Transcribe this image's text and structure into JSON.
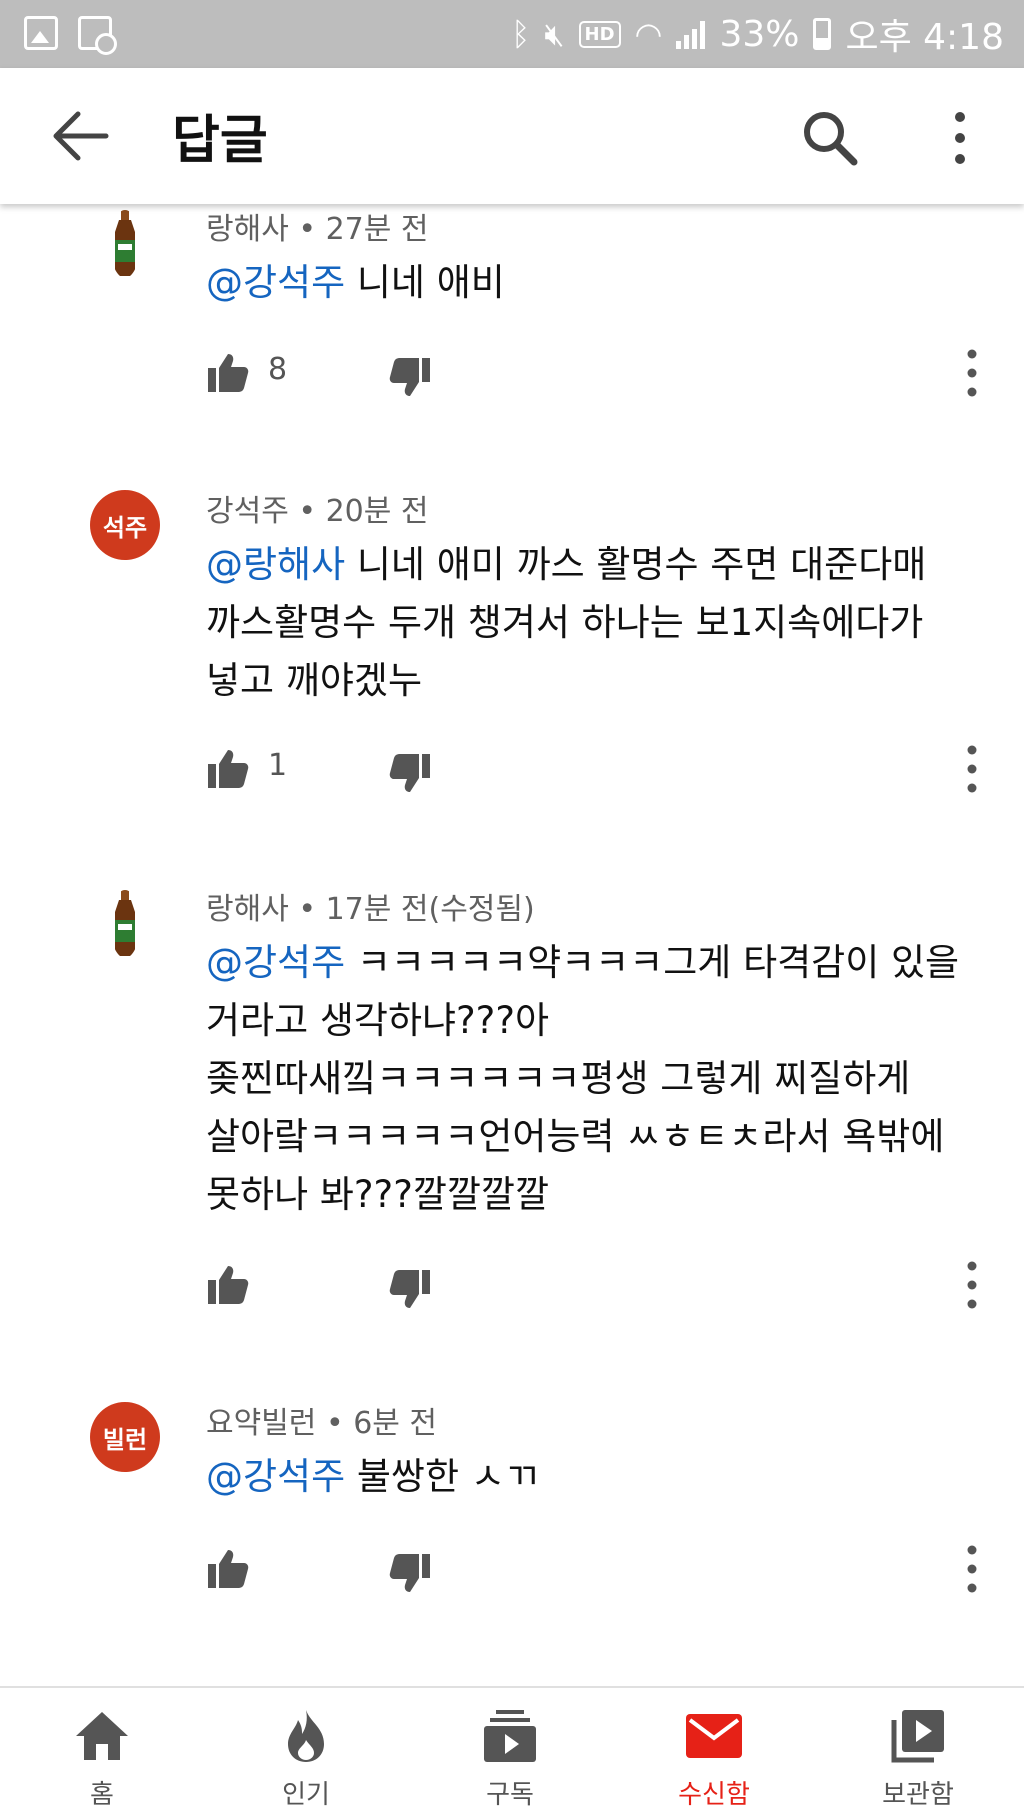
{
  "status_bar": {
    "battery": "33%",
    "time": "오후 4:18",
    "hd_label": "HD"
  },
  "app_bar": {
    "title": "답글"
  },
  "comments": [
    {
      "author": "랑해사",
      "time": "27분 전",
      "mention": "@강석주",
      "text": " 니네 애비",
      "likes": "8",
      "avatar_text": ""
    },
    {
      "author": "강석주",
      "time": "20분 전",
      "mention": "@랑해사",
      "text": " 니네 애미 까스 활명수 주면 대준다매\n까스활명수 두개 챙겨서 하나는 보1지속에다가\n넣고 깨야겠누",
      "likes": "1",
      "avatar_text": "석주"
    },
    {
      "author": "랑해사",
      "time": "17분 전(수정됨)",
      "mention": "@강석주",
      "text": " ㅋㅋㅋㅋㅋ약ㅋㅋㅋ그게 타격감이 있을\n거라고 생각하냐???아\n좆찐따새낔ㅋㅋㅋㅋㅋㅋ평생 그렇게 찌질하게\n살아랔ㅋㅋㅋㅋㅋ언어능력 ㅆㅎㅌㅊ라서 욕밖에\n못하나 봐???깔깔깔깔",
      "likes": "",
      "avatar_text": ""
    },
    {
      "author": "요약빌런",
      "time": "6분 전",
      "mention": "@강석주",
      "text": " 불쌍한 ㅅㄲ",
      "likes": "",
      "avatar_text": "빌런"
    }
  ],
  "bottom_nav": {
    "items": [
      {
        "label": "홈",
        "icon": "home-icon",
        "active": false
      },
      {
        "label": "인기",
        "icon": "trending-flame-icon",
        "active": false
      },
      {
        "label": "구독",
        "icon": "subscriptions-icon",
        "active": false
      },
      {
        "label": "수신함",
        "icon": "inbox-mail-icon",
        "active": true
      },
      {
        "label": "보관함",
        "icon": "library-icon",
        "active": false
      }
    ],
    "active_color": "#e62117"
  },
  "colors": {
    "mention": "#1565c0",
    "avatar_red": "#cf3a1d",
    "status_bar_bg": "#bdbdbd"
  }
}
